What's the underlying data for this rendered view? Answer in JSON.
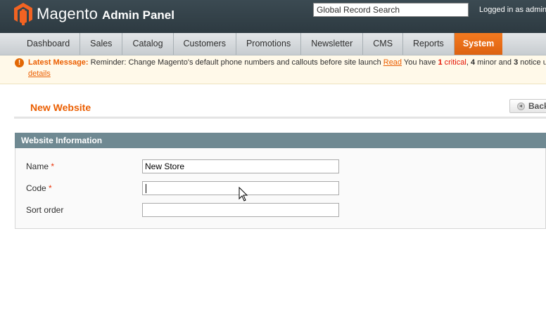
{
  "header": {
    "logo_text": "Magento",
    "logo_sub": "Admin Panel",
    "search_value": "Global Record Search",
    "logged_in": "Logged in as admin"
  },
  "nav": {
    "items": [
      "Dashboard",
      "Sales",
      "Catalog",
      "Customers",
      "Promotions",
      "Newsletter",
      "CMS",
      "Reports",
      "System"
    ],
    "active": "System"
  },
  "message": {
    "label": "Latest Message:",
    "text": "Reminder: Change Magento's default phone numbers and callouts before site launch",
    "read_link": "Read",
    "you_have": "You have",
    "critical_count": "1",
    "critical_label": "critical",
    "minor_count": "4",
    "minor_label": "minor and",
    "notice_count": "3",
    "notice_label": "notice u",
    "details_link": "details"
  },
  "page": {
    "title": "New Website",
    "back_label": "Back"
  },
  "form": {
    "section_title": "Website Information",
    "name_label": "Name",
    "name_value": "New Store",
    "code_label": "Code",
    "code_value": "",
    "sort_label": "Sort order",
    "sort_value": "",
    "required_mark": "*"
  },
  "colors": {
    "accent": "#eb5e00",
    "header_bg": "#2d3a41",
    "section_bg": "#6f8992"
  }
}
